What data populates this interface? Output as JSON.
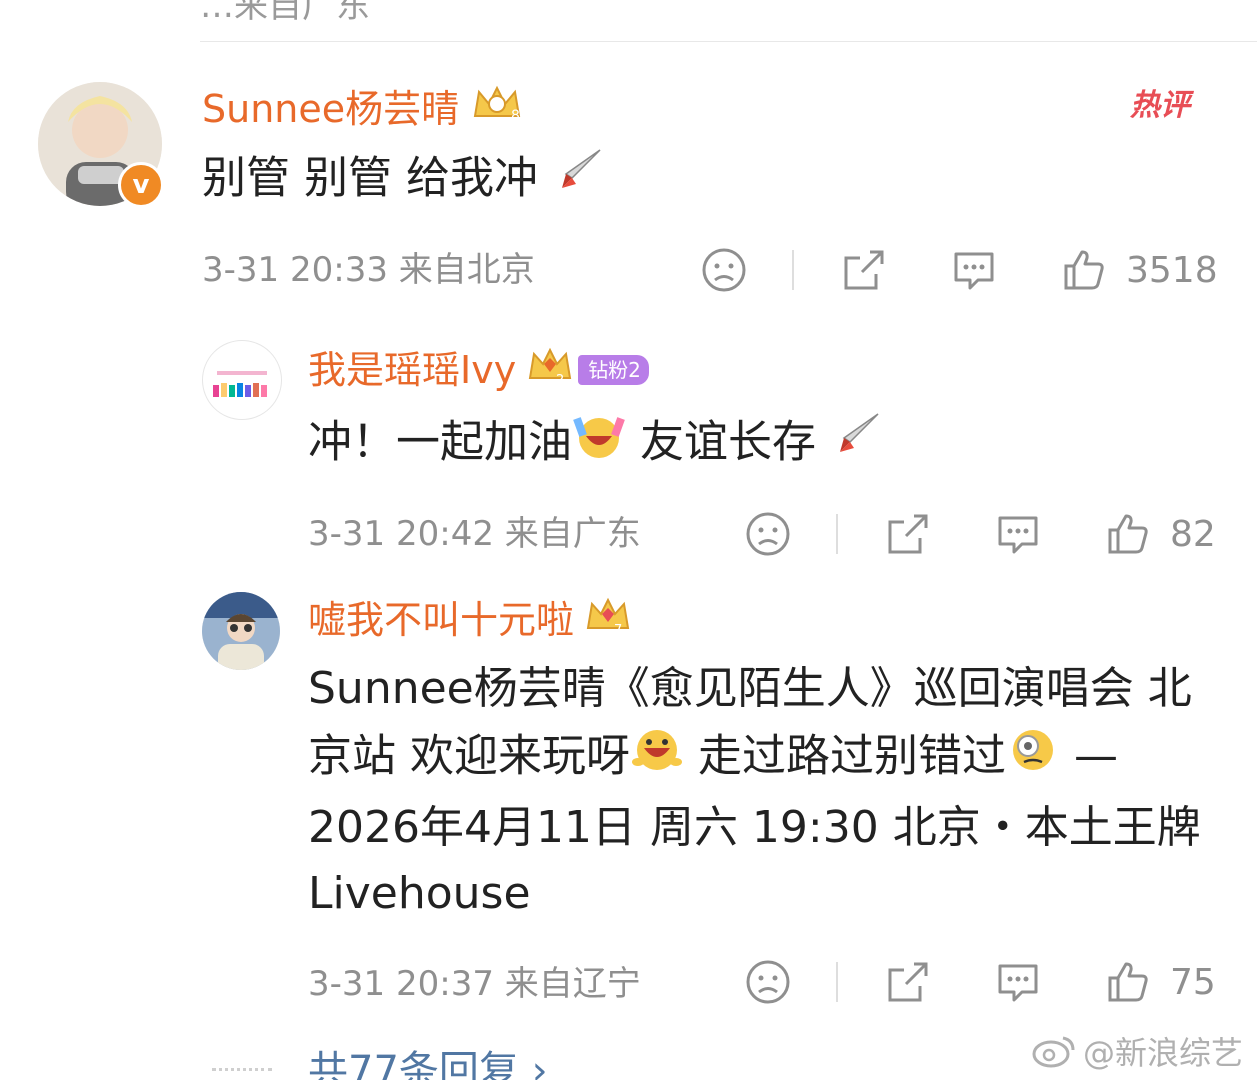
{
  "previous_comment": {
    "partial_meta": "…来自广东"
  },
  "hot_label": "热评",
  "comments": [
    {
      "username": "Sunnee杨芸晴",
      "text": "别管 别管 给我冲",
      "time": "3-31 20:33",
      "location": "来自北京",
      "likes": "3518",
      "verified": "v"
    },
    {
      "username": "我是瑶瑶Ivy",
      "fan_badge": "钻粉2",
      "text_a": "冲！一起加油",
      "text_b": " 友谊长存",
      "time": "3-31 20:42",
      "location": "来自广东",
      "likes": "82"
    },
    {
      "username": "嘘我不叫十元啦",
      "text_a": "Sunnee杨芸晴《愈见陌生人》巡回演唱会 北京站 欢迎来玩呀",
      "text_b": " 走过路过别错过",
      "text_c": " — 2026年4月11日 周六 19:30 北京・本土王牌 Livehouse",
      "time": "3-31 20:37",
      "location": "来自辽宁",
      "likes": "75"
    }
  ],
  "more_replies": "共77条回复",
  "watermark": "@新浪综艺",
  "colors": {
    "username": "#e8692a",
    "hot": "#e84d55",
    "link": "#5177a3",
    "meta": "#8f8f8f"
  }
}
